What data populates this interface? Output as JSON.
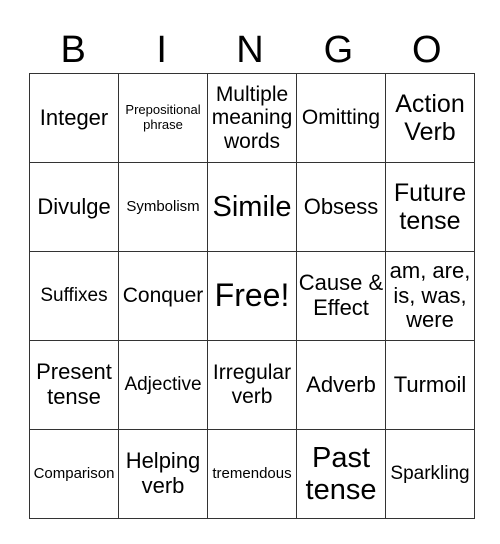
{
  "header": [
    "B",
    "I",
    "N",
    "G",
    "O"
  ],
  "rows": [
    [
      "Integer",
      "Prepositional phrase",
      "Multiple meaning words",
      "Omitting",
      "Action Verb"
    ],
    [
      "Divulge",
      "Symbolism",
      "Simile",
      "Obsess",
      "Future tense"
    ],
    [
      "Suffixes",
      "Conquer",
      "Free!",
      "Cause & Effect",
      "am, are, is, was, were"
    ],
    [
      "Present tense",
      "Adjective",
      "Irregular verb",
      "Adverb",
      "Turmoil"
    ],
    [
      "Comparison",
      "Helping verb",
      "tremendous",
      "Past tense",
      "Sparkling"
    ]
  ]
}
